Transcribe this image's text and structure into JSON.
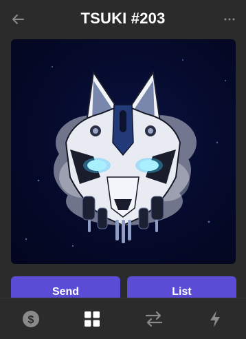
{
  "header": {
    "title": "TSUKI #203",
    "back_icon": "arrow-left-icon",
    "more_icon": "more-horizontal-icon"
  },
  "nft": {
    "image_icon": "mecha-fox-mask-artwork"
  },
  "actions": {
    "send_label": "Send",
    "list_label": "List"
  },
  "bottom_nav": {
    "items": [
      {
        "icon": "dollar-coin-icon",
        "active": false
      },
      {
        "icon": "grid-icon",
        "active": true
      },
      {
        "icon": "swap-arrows-icon",
        "active": false
      },
      {
        "icon": "lightning-icon",
        "active": false
      }
    ]
  },
  "colors": {
    "background": "#2b2b2b",
    "accent": "#5b4cd6",
    "icon_inactive": "#8a8a8a",
    "icon_active": "#ffffff",
    "image_bg": "#050a2b"
  }
}
